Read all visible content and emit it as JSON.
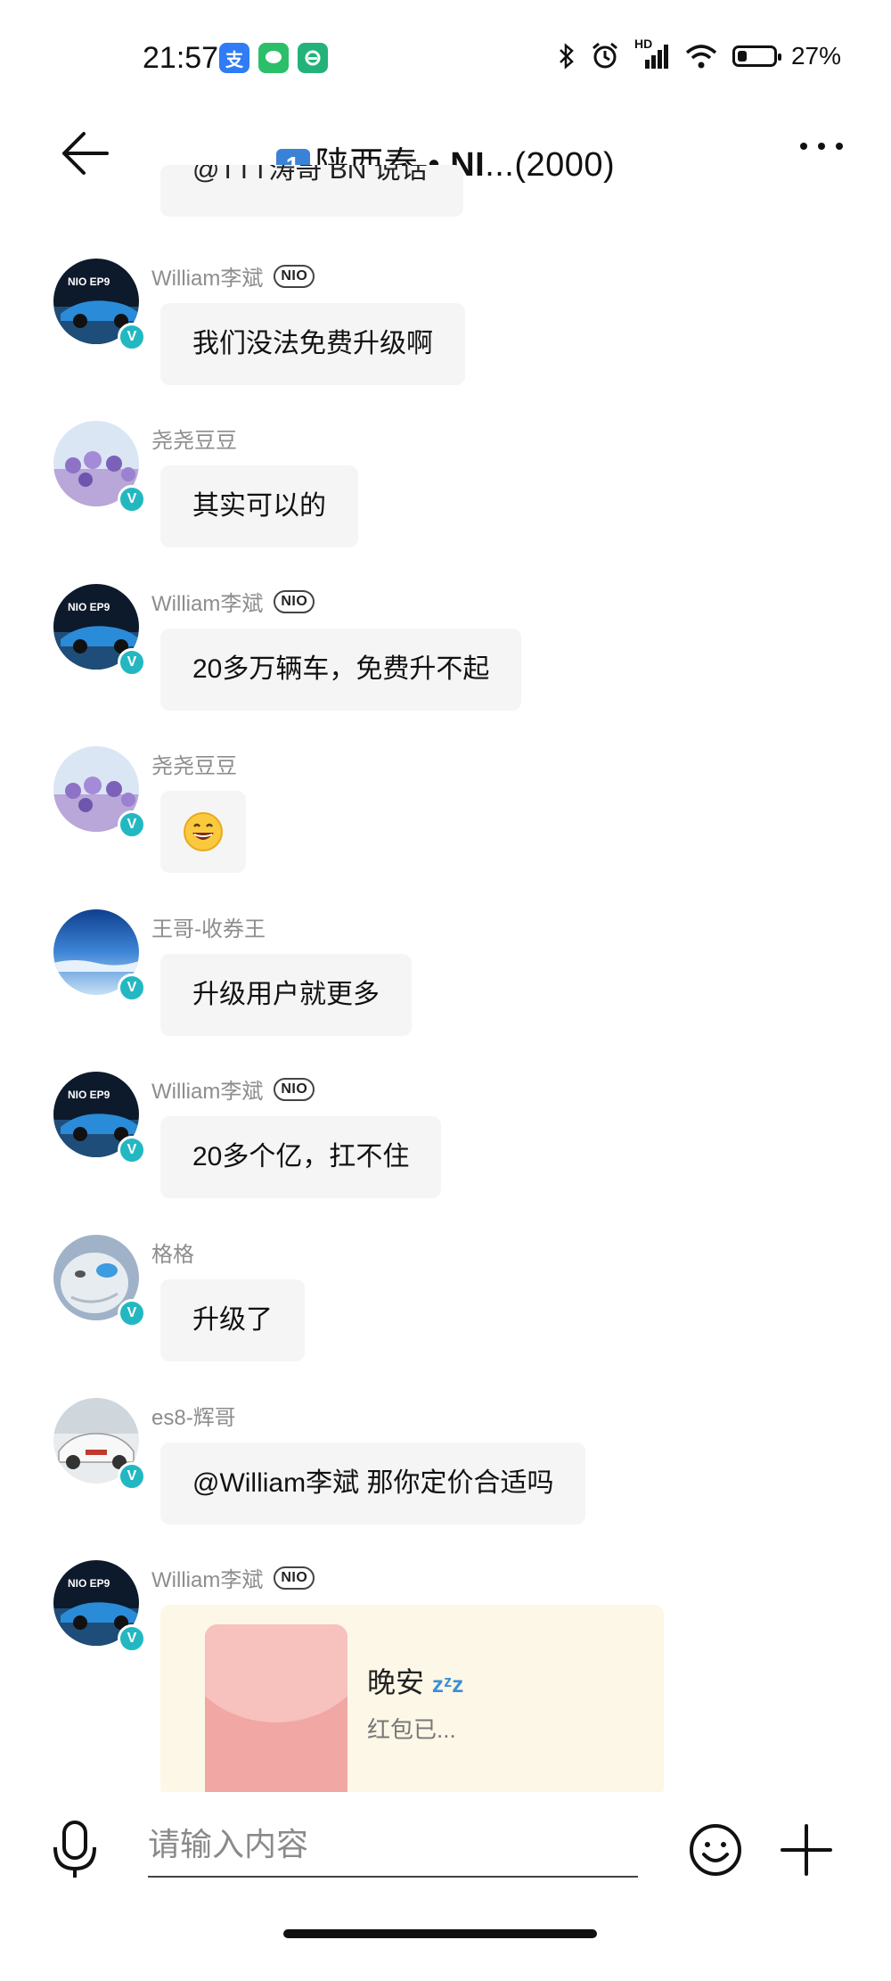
{
  "status_bar": {
    "time": "21:57",
    "app_icons": [
      {
        "name": "alipay-icon",
        "glyph": "支",
        "color": "#2f7cf6"
      },
      {
        "name": "wechat-icon",
        "glyph": "●",
        "color": "#2bbf6a"
      },
      {
        "name": "wifi-assistant-icon",
        "glyph": "◎",
        "color": "#23b37a"
      }
    ],
    "network": "HD",
    "battery_percent": "27%",
    "battery_level": 0.27
  },
  "header": {
    "title_number": "1",
    "title_text": "陕西秦 • ",
    "title_bold": "NI",
    "title_suffix": "...(2000)"
  },
  "chat": {
    "clipped_text": "@TTT涛哥 BN 说话",
    "messages": [
      {
        "sender": "William李斌",
        "nio": true,
        "text": "我们没法免费升级啊",
        "avatar": "car"
      },
      {
        "sender": "尧尧豆豆",
        "nio": false,
        "text": "其实可以的",
        "avatar": "lavender"
      },
      {
        "sender": "William李斌",
        "nio": true,
        "text": "20多万辆车，免费升不起",
        "avatar": "car"
      },
      {
        "sender": "尧尧豆豆",
        "nio": false,
        "text": "",
        "emoji": "grinning-face",
        "avatar": "lavender"
      },
      {
        "sender": "王哥-收券王",
        "nio": false,
        "text": "升级用户就更多",
        "avatar": "sea"
      },
      {
        "sender": "William李斌",
        "nio": true,
        "text": "20多个亿，扛不住",
        "avatar": "car"
      },
      {
        "sender": "格格",
        "nio": false,
        "text": "升级了",
        "avatar": "cat"
      },
      {
        "sender": "es8-辉哥",
        "nio": false,
        "text": "@William李斌 那你定价合适吗",
        "avatar": "es8"
      }
    ],
    "nio_tag": "NIO",
    "verified_badge": "V",
    "red_packet": {
      "sender": "William李斌",
      "title": "晚安",
      "title_emoji": "💤",
      "status": "红包已..."
    }
  },
  "input_bar": {
    "placeholder": "请输入内容"
  },
  "icons": {
    "back": "back-arrow-icon",
    "more": "more-dots-icon",
    "mic": "microphone-icon",
    "emoji": "emoji-icon",
    "plus": "plus-icon"
  }
}
